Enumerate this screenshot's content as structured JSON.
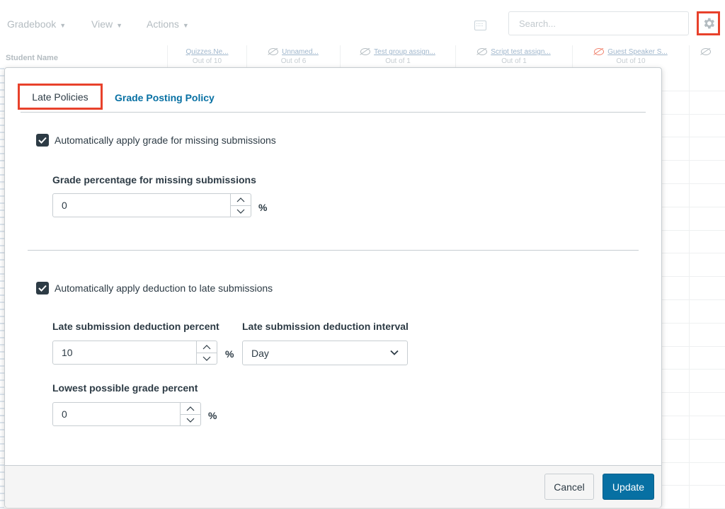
{
  "toolbar": {
    "gradebook_menu": "Gradebook",
    "view_menu": "View",
    "actions_menu": "Actions",
    "search_placeholder": "Search..."
  },
  "grid": {
    "student_name_header": "Student Name",
    "columns": [
      {
        "title": "Quizzes.Ne...",
        "out_of": "Out of 10"
      },
      {
        "title": "Unnamed...",
        "out_of": "Out of 6"
      },
      {
        "title": "Test group assign...",
        "out_of": "Out of 1"
      },
      {
        "title": "Script test assign...",
        "out_of": "Out of 1"
      },
      {
        "title": "Guest Speaker S...",
        "out_of": "Out of 10"
      }
    ]
  },
  "modal": {
    "tabs": {
      "late_policies": "Late Policies",
      "grade_posting": "Grade Posting Policy"
    },
    "missing": {
      "checkbox_label": "Automatically apply grade for missing submissions",
      "checked": true,
      "field_label": "Grade percentage for missing submissions",
      "value": "0",
      "unit": "%"
    },
    "late": {
      "checkbox_label": "Automatically apply deduction to late submissions",
      "checked": true,
      "deduction_label": "Late submission deduction percent",
      "deduction_value": "10",
      "deduction_unit": "%",
      "interval_label": "Late submission deduction interval",
      "interval_value": "Day",
      "lowest_label": "Lowest possible grade percent",
      "lowest_value": "0",
      "lowest_unit": "%"
    },
    "footer": {
      "cancel": "Cancel",
      "update": "Update"
    }
  },
  "colors": {
    "primary": "#0770a3",
    "highlight": "#e8412b",
    "text": "#2d3b45"
  },
  "icons": [
    "gear-icon",
    "keyboard-icon",
    "eye-off-icon",
    "checkmark-icon",
    "chevron-up-icon",
    "chevron-down-icon"
  ]
}
